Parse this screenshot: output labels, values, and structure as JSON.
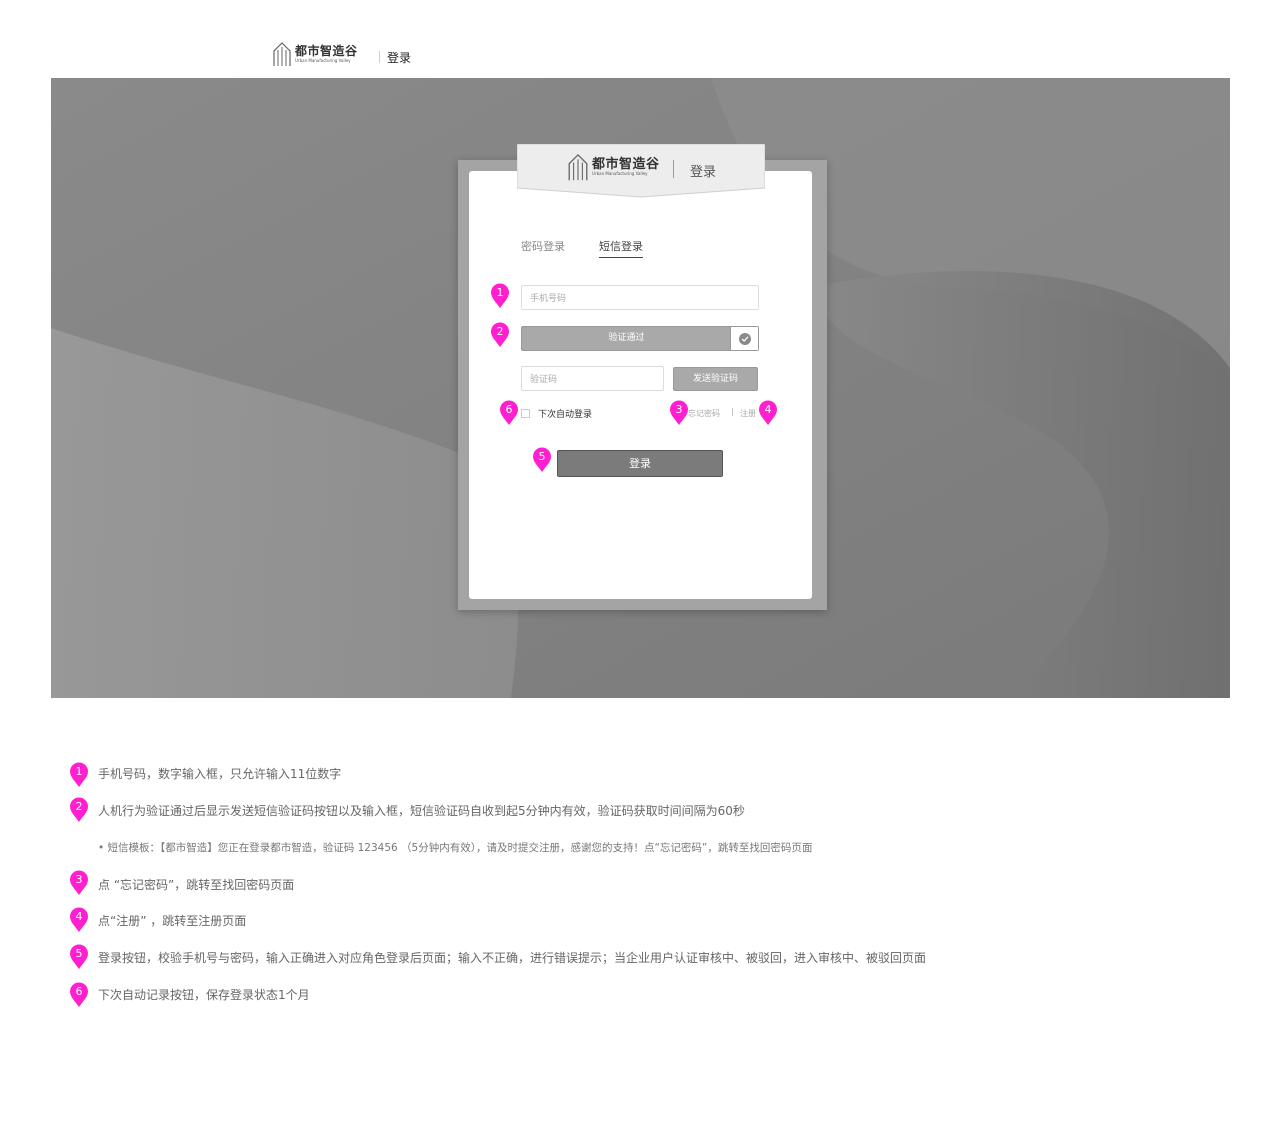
{
  "header": {
    "logo_cn": "都市智造谷",
    "logo_en": "Urban Manufacturing Valley",
    "page_title": "登录"
  },
  "login_card": {
    "logo_cn": "都市智造谷",
    "logo_en": "Urban Manufacturing Valley",
    "title": "登录",
    "tabs": [
      {
        "label": "密码登录",
        "active": false
      },
      {
        "label": "短信登录",
        "active": true
      }
    ],
    "phone_placeholder": "手机号码",
    "verify_label": "验证通过",
    "code_placeholder": "验证码",
    "send_code_label": "发送验证码",
    "remember_label": "下次自动登录",
    "forgot_label": "忘记密码",
    "link_separator": "|",
    "register_label": "注册",
    "login_button": "登录"
  },
  "markers": [
    "1",
    "2",
    "3",
    "4",
    "5",
    "6"
  ],
  "notes": [
    {
      "num": "1",
      "text": "手机号码，数字输入框，只允许输入11位数字"
    },
    {
      "num": "2",
      "text": "人机行为验证通过后显示发送短信验证码按钮以及输入框，短信验证码自收到起5分钟内有效，验证码获取时间间隔为60秒"
    },
    {
      "num": "",
      "text": "• 短信模板：【都市智造】您正在登录都市智造，验证码 123456 （5分钟内有效），请及时提交注册，感谢您的支持！点“忘记密码”，跳转至找回密码页面"
    },
    {
      "num": "3",
      "text": "点 “忘记密码”，跳转至找回密码页面"
    },
    {
      "num": "4",
      "text": "点“注册” ，跳转至注册页面"
    },
    {
      "num": "5",
      "text": "登录按钮，校验手机号与密码，输入正确进入对应角色登录后页面；输入不正确，进行错误提示；当企业用户认证审核中、被驳回，进入审核中、被驳回页面"
    },
    {
      "num": "6",
      "text": "下次自动记录按钮，保存登录状态1个月"
    }
  ],
  "colors": {
    "marker": "#ff1fd1",
    "banner": "#8c8c8c",
    "login_button": "#7b7b7b"
  }
}
